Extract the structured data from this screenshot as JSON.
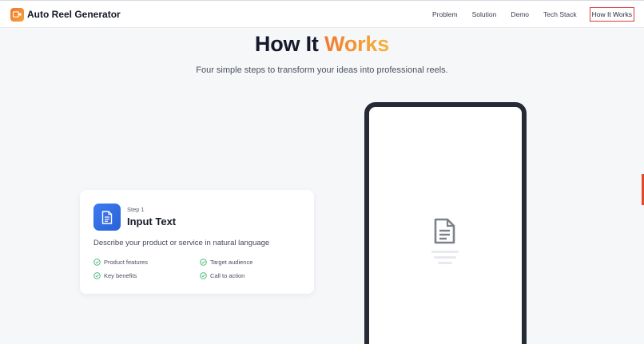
{
  "app": {
    "name": "Auto Reel Generator",
    "logo_icon": "video-camera-icon"
  },
  "nav": {
    "items": [
      {
        "label": "Problem"
      },
      {
        "label": "Solution"
      },
      {
        "label": "Demo"
      },
      {
        "label": "Tech Stack"
      },
      {
        "label": "How It Works",
        "active": true
      }
    ]
  },
  "hero": {
    "title_main": "How It",
    "title_accent": "Works",
    "subtitle": "Four simple steps to transform your ideas into professional reels."
  },
  "step": {
    "number_label": "Step 1",
    "title": "Input Text",
    "description": "Describe your product or service in natural language",
    "icon": "document-icon",
    "features": [
      "Product features",
      "Target audience",
      "Key benefits",
      "Call to action"
    ]
  },
  "phone": {
    "icon": "document-icon"
  },
  "colors": {
    "accent_orange": "#f27a2f",
    "accent_blue": "#2f6ae0",
    "check_green": "#3bb36a",
    "active_border": "#d93c3c"
  }
}
